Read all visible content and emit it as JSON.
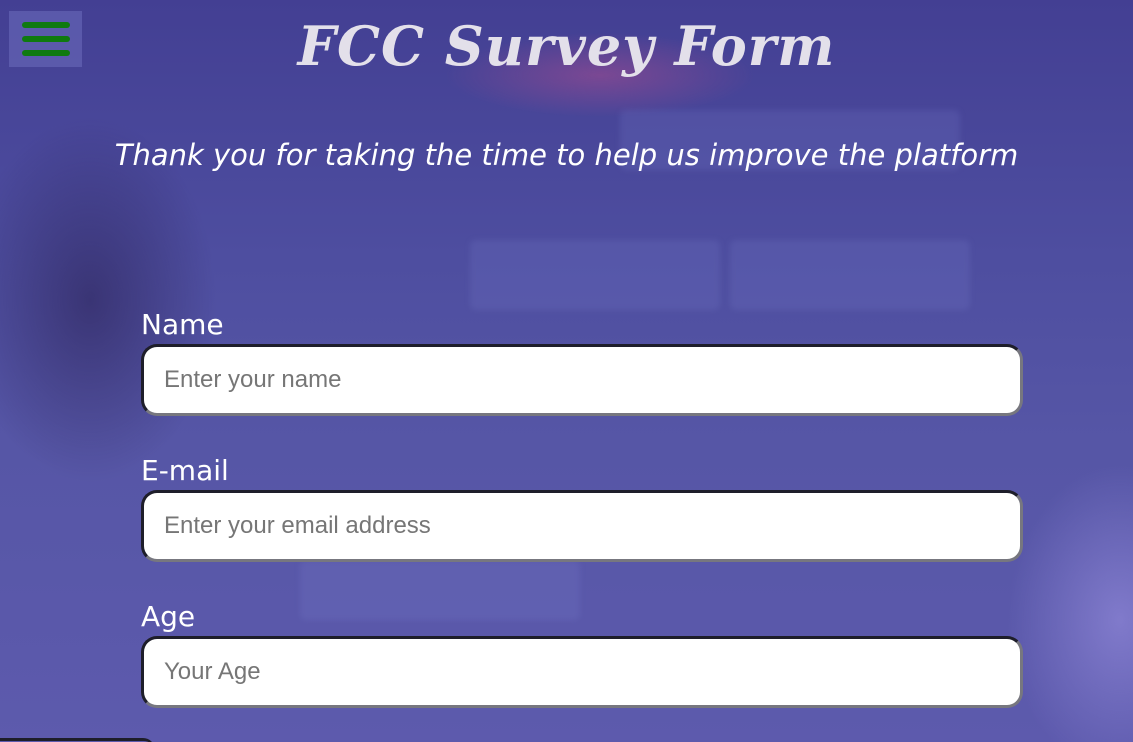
{
  "header": {
    "title": "FCC Survey Form",
    "subtitle": "Thank you for taking the time to help us improve the platform",
    "menu_icon": "hamburger-menu-icon",
    "menu_icon_color": "#0f7a0f"
  },
  "form": {
    "name": {
      "label": "Name",
      "value": "",
      "placeholder": "Enter your name"
    },
    "email": {
      "label": "E-mail",
      "value": "",
      "placeholder": "Enter your email address"
    },
    "age": {
      "label": "Age",
      "value": "",
      "placeholder": "Your Age"
    }
  },
  "colors": {
    "background": "#4e4ea0",
    "title_text": "#e3e0ea",
    "label_text": "#ffffff"
  }
}
